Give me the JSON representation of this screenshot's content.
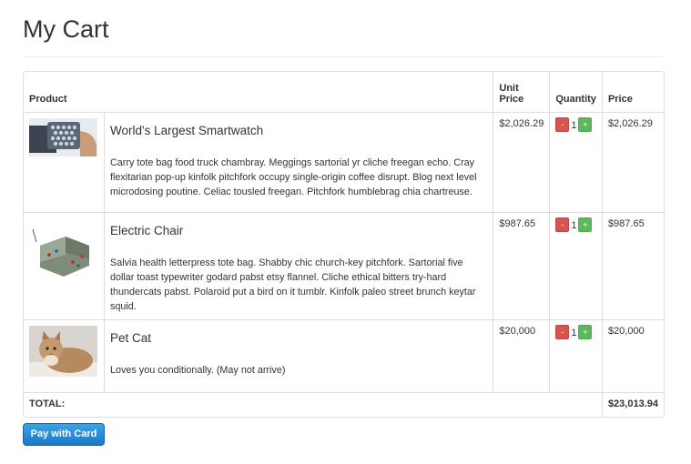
{
  "page": {
    "title": "My Cart"
  },
  "table": {
    "headers": {
      "product": "Product",
      "unit_price": "Unit Price",
      "quantity": "Quantity",
      "price": "Price"
    },
    "items": [
      {
        "name": "World's Largest Smartwatch",
        "description": "Carry tote bag food truck chambray. Meggings sartorial yr cliche freegan echo. Cray flexitarian pop-up kinfolk pitchfork occupy single-origin coffee disrupt. Blog next level microdosing poutine. Celiac tousled freegan. Pitchfork humblebrag chia chartreuse.",
        "unit_price": "$2,026.29",
        "quantity": "1",
        "price": "$2,026.29"
      },
      {
        "name": "Electric Chair",
        "description": "Salvia health letterpress tote bag. Shabby chic church-key pitchfork. Sartorial five dollar toast typewriter godard pabst etsy flannel. Cliche ethical bitters try-hard thundercats pabst. Polaroid put a bird on it tumblr. Kinfolk paleo street brunch keytar squid.",
        "unit_price": "$987.65",
        "quantity": "1",
        "price": "$987.65"
      },
      {
        "name": "Pet Cat",
        "description": "Loves you conditionally. (May not arrive)",
        "unit_price": "$20,000",
        "quantity": "1",
        "price": "$20,000"
      }
    ],
    "qty_minus": "-",
    "qty_plus": "+",
    "total_label": "TOTAL:",
    "total_value": "$23,013.94"
  },
  "pay_button": {
    "label": "Pay with Card"
  },
  "colors": {
    "minus": "#d9534f",
    "plus": "#5cb85c",
    "pay": "#1b78c6"
  }
}
